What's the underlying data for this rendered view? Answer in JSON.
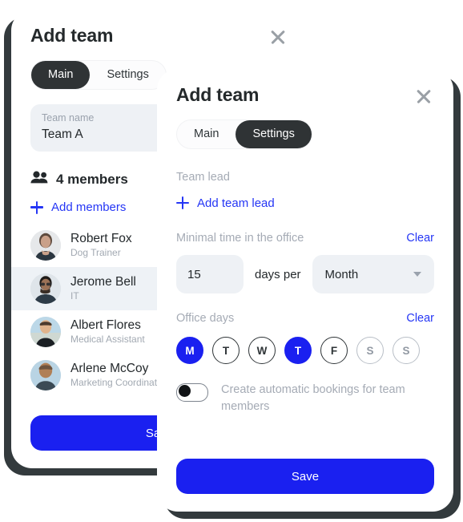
{
  "back_dialog": {
    "title": "Add team",
    "close_icon": "close-icon",
    "tabs": [
      {
        "label": "Main",
        "active": true
      },
      {
        "label": "Settings",
        "active": false
      }
    ],
    "team_name_field": {
      "label": "Team name",
      "value": "Team A"
    },
    "members_icon": "people-icon",
    "members_count_label": "4 members",
    "add_members_label": "Add members",
    "add_icon": "plus-icon",
    "members": [
      {
        "name": "Robert Fox",
        "role": "Dog Trainer",
        "selected": false
      },
      {
        "name": "Jerome Bell",
        "role": "IT",
        "selected": true
      },
      {
        "name": "Albert Flores",
        "role": "Medical Assistant",
        "selected": false
      },
      {
        "name": "Arlene McCoy",
        "role": "Marketing Coordinator",
        "selected": false
      }
    ],
    "save_label": "Save"
  },
  "front_dialog": {
    "title": "Add team",
    "close_icon": "close-icon",
    "tabs": [
      {
        "label": "Main",
        "active": false
      },
      {
        "label": "Settings",
        "active": true
      }
    ],
    "team_lead": {
      "label": "Team lead",
      "add_label": "Add team lead",
      "add_icon": "plus-icon"
    },
    "minimal_time": {
      "label": "Minimal time in the office",
      "clear_label": "Clear",
      "days_value": "15",
      "days_placeholder": "0",
      "per_label": "days per",
      "period_value": "Month",
      "caret_icon": "chevron-down-icon"
    },
    "office_days": {
      "label": "Office days",
      "clear_label": "Clear",
      "days": [
        {
          "letter": "M",
          "on": true,
          "weekend": false
        },
        {
          "letter": "T",
          "on": false,
          "weekend": false
        },
        {
          "letter": "W",
          "on": false,
          "weekend": false
        },
        {
          "letter": "T",
          "on": true,
          "weekend": false
        },
        {
          "letter": "F",
          "on": false,
          "weekend": false
        },
        {
          "letter": "S",
          "on": false,
          "weekend": true
        },
        {
          "letter": "S",
          "on": false,
          "weekend": true
        }
      ]
    },
    "auto_bookings": {
      "label": "Create automatic bookings for team members",
      "enabled": false
    },
    "save_label": "Save"
  },
  "colors": {
    "accent_blue": "#1a20f0",
    "link_blue": "#2536f5",
    "dark": "#2f3335",
    "field_bg": "#eef1f5",
    "muted_text": "#a5abb5",
    "shadow": "#333a3d"
  }
}
